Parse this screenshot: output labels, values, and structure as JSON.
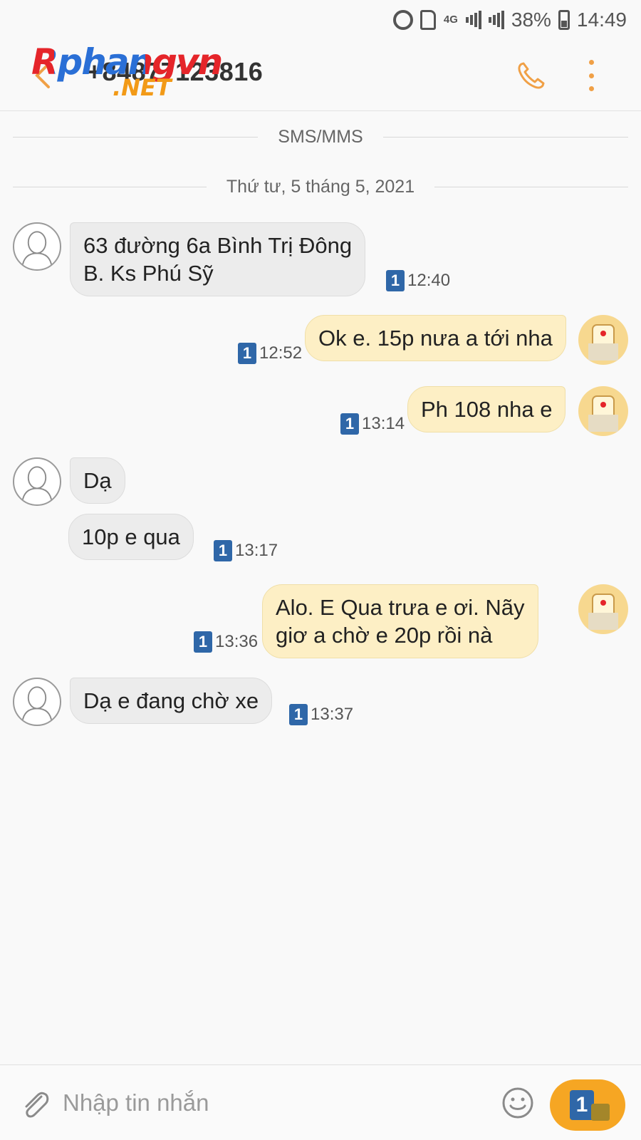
{
  "status_bar": {
    "network": "4G",
    "battery": "38%",
    "time": "14:49"
  },
  "header": {
    "contact": "+84877123816",
    "logo_main": "Rphangvn",
    "logo_suffix": ".NET"
  },
  "thread": {
    "channel_label": "SMS/MMS",
    "date_label": "Thứ tư, 5 tháng 5, 2021"
  },
  "messages": [
    {
      "dir": "in",
      "lines": [
        "63 đường 6a Bình Trị Đông",
        "B. Ks Phú Sỹ"
      ],
      "sim": "1",
      "time": "12:40"
    },
    {
      "dir": "out",
      "lines": [
        "Ok e. 15p nưa a tới nha"
      ],
      "sim": "1",
      "time": "12:52"
    },
    {
      "dir": "out",
      "lines": [
        "Ph 108 nha e"
      ],
      "sim": "1",
      "time": "13:14"
    },
    {
      "dir": "in",
      "lines": [
        "Dạ"
      ],
      "sim": "",
      "time": ""
    },
    {
      "dir": "in",
      "lines": [
        "10p e qua"
      ],
      "sim": "1",
      "time": "13:17"
    },
    {
      "dir": "out",
      "lines": [
        "Alo. E Qua trưa e ơi. Nãy",
        "giơ a chờ e 20p rồi nà"
      ],
      "sim": "1",
      "time": "13:36"
    },
    {
      "dir": "in",
      "lines": [
        "Dạ e đang chờ xe"
      ],
      "sim": "1",
      "time": "13:37"
    }
  ],
  "composer": {
    "placeholder": "Nhập tin nhắn",
    "send_sim": "1"
  },
  "colors": {
    "accent": "#f0a046",
    "outgoing_bubble": "#fdefc5",
    "incoming_bubble": "#ececec",
    "sim_badge": "#2f67a8",
    "send_button": "#f6a623"
  },
  "icons": [
    "back-icon",
    "call-icon",
    "more-icon",
    "attach-icon",
    "emoji-icon",
    "alarm-icon",
    "signal-icon",
    "battery-icon"
  ]
}
